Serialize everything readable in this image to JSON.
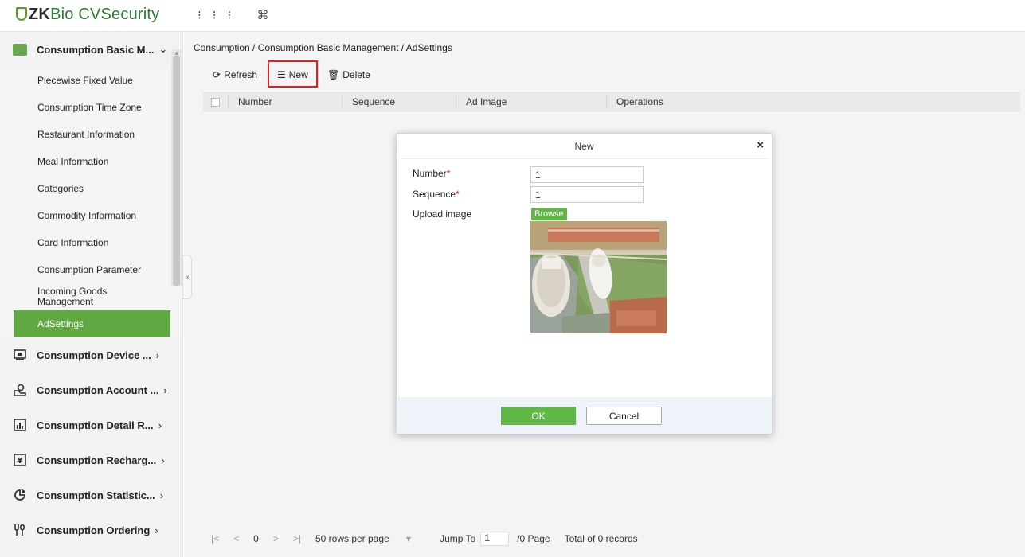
{
  "app": {
    "logo_zk": "ZK",
    "logo_rest": "Bio CVSecurity",
    "top_icons": [
      "grid-icon",
      "command-icon"
    ]
  },
  "sidebar": {
    "active_group": "Consumption Basic M...",
    "sub_items": [
      "Piecewise Fixed Value",
      "Consumption Time Zone",
      "Restaurant Information",
      "Meal Information",
      "Categories",
      "Commodity Information",
      "Card Information",
      "Consumption Parameter",
      "Incoming Goods Management",
      "AdSettings"
    ],
    "groups": [
      "Consumption Device ...",
      "Consumption Account ...",
      "Consumption Detail R...",
      "Consumption Recharg...",
      "Consumption Statistic...",
      "Consumption Ordering"
    ],
    "accent_color": "#5fa842"
  },
  "main": {
    "breadcrumb": "Consumption / Consumption Basic Management / AdSettings",
    "toolbar": {
      "refresh": "Refresh",
      "new": "New",
      "delete": "Delete"
    },
    "columns": [
      "Number",
      "Sequence",
      "Ad Image",
      "Operations"
    ],
    "pager": {
      "first": "|<",
      "prev": "<",
      "page": "0",
      "next": ">",
      "last": ">|",
      "rows_per_page": "50 rows per page",
      "jump_to": "Jump To",
      "jump_value": "1",
      "page_count": "/0 Page",
      "total": "Total of 0 records"
    }
  },
  "dialog": {
    "title": "New",
    "close": "×",
    "number_label": "Number",
    "number_value": "1",
    "sequence_label": "Sequence",
    "sequence_value": "1",
    "upload_label": "Upload image",
    "browse": "Browse",
    "ok": "OK",
    "cancel": "Cancel"
  }
}
